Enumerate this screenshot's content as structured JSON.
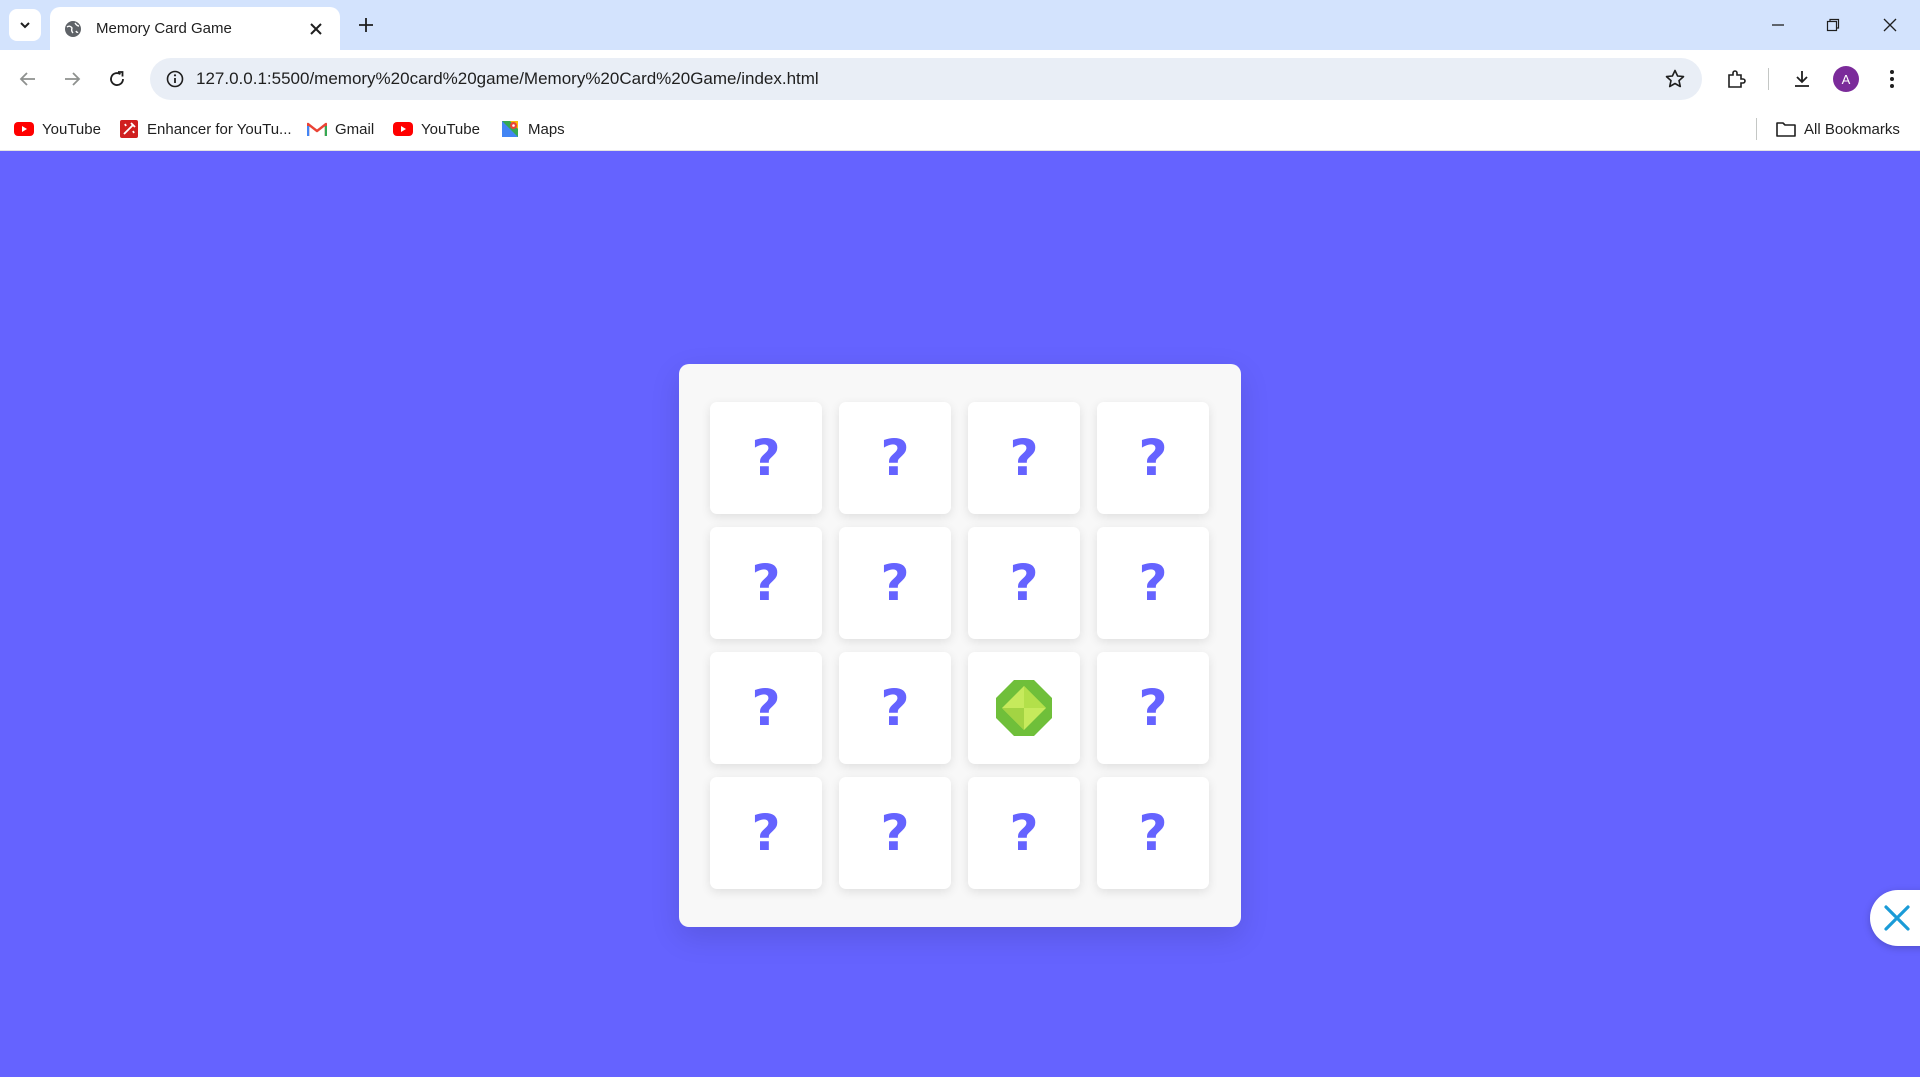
{
  "browser": {
    "tab": {
      "title": "Memory Card Game"
    },
    "address_bar": {
      "url": "127.0.0.1:5500/memory%20card%20game/Memory%20Card%20Game/index.html"
    },
    "profile_initial": "A",
    "bookmarks": [
      {
        "label": "YouTube",
        "icon": "youtube-icon"
      },
      {
        "label": "Enhancer for YouTu...",
        "icon": "enhancer-icon"
      },
      {
        "label": "Gmail",
        "icon": "gmail-icon"
      },
      {
        "label": "YouTube",
        "icon": "youtube-icon"
      },
      {
        "label": "Maps",
        "icon": "maps-icon"
      }
    ],
    "all_bookmarks_label": "All Bookmarks"
  },
  "game": {
    "cards": [
      {
        "face": "?",
        "flipped": false
      },
      {
        "face": "?",
        "flipped": false
      },
      {
        "face": "?",
        "flipped": false
      },
      {
        "face": "?",
        "flipped": false
      },
      {
        "face": "?",
        "flipped": false
      },
      {
        "face": "?",
        "flipped": false
      },
      {
        "face": "?",
        "flipped": false
      },
      {
        "face": "?",
        "flipped": false
      },
      {
        "face": "?",
        "flipped": false
      },
      {
        "face": "?",
        "flipped": false
      },
      {
        "face": "gem-icon",
        "flipped": true
      },
      {
        "face": "?",
        "flipped": false
      },
      {
        "face": "?",
        "flipped": false
      },
      {
        "face": "?",
        "flipped": false
      },
      {
        "face": "?",
        "flipped": false
      },
      {
        "face": "?",
        "flipped": false
      }
    ]
  },
  "colors": {
    "background": "#6563ff",
    "board": "#f8f8f8",
    "card": "#ffffff",
    "question_mark": "#6563ff"
  }
}
